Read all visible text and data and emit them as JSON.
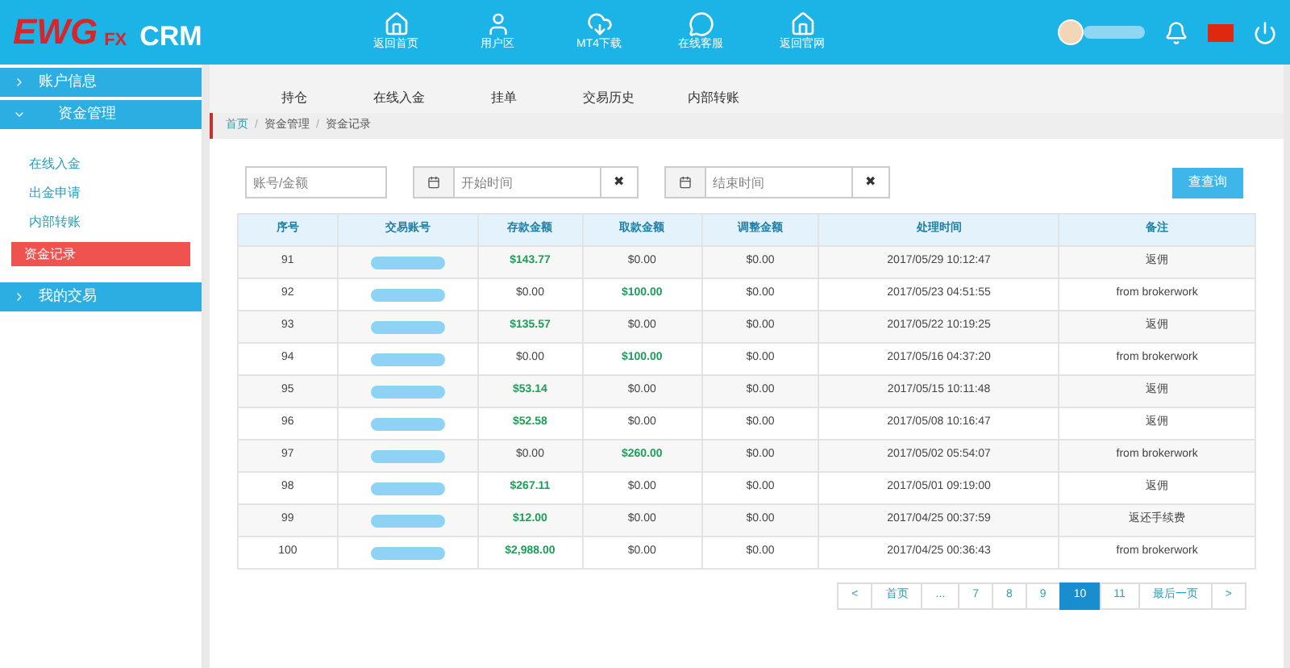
{
  "header": {
    "logo_main": "EWG",
    "logo_sub": "FX",
    "logo_crm": "CRM",
    "nav": [
      {
        "label": "返回首页",
        "kind": "home"
      },
      {
        "label": "用户区",
        "kind": "user"
      },
      {
        "label": "MT4下载",
        "kind": "download"
      },
      {
        "label": "在线客服",
        "kind": "chat"
      },
      {
        "label": "返回官网",
        "kind": "home"
      }
    ]
  },
  "sidebar": {
    "items": [
      {
        "label": "账户信息",
        "expanded": false
      },
      {
        "label": "资金管理",
        "expanded": true,
        "children": [
          {
            "label": "在线入金",
            "selected": false
          },
          {
            "label": "出金申请",
            "selected": false
          },
          {
            "label": "内部转账",
            "selected": false
          },
          {
            "label": "资金记录",
            "selected": true
          }
        ]
      },
      {
        "label": "我的交易",
        "expanded": false
      }
    ]
  },
  "tabs": [
    "持仓",
    "在线入金",
    "挂单",
    "交易历史",
    "内部转账"
  ],
  "breadcrumb": {
    "separator": "/",
    "items": [
      "首页",
      "资金管理",
      "资金记录"
    ]
  },
  "filters": {
    "account_placeholder": "账号/金额",
    "start_placeholder": "开始时间",
    "end_placeholder": "结束时间",
    "clear": "✖",
    "search_button": "查查询"
  },
  "table": {
    "columns": [
      "序号",
      "交易账号",
      "存款金额",
      "取款金额",
      "调整金额",
      "处理时间",
      "备注"
    ],
    "rows": [
      {
        "no": "91",
        "deposit": {
          "text": "$143.77",
          "emphasis": true
        },
        "withdraw": {
          "text": "$0.00",
          "emphasis": false
        },
        "adjust": "$0.00",
        "time": "2017/05/29 10:12:47",
        "note": "返佣"
      },
      {
        "no": "92",
        "deposit": {
          "text": "$0.00",
          "emphasis": false
        },
        "withdraw": {
          "text": "$100.00",
          "emphasis": true
        },
        "adjust": "$0.00",
        "time": "2017/05/23 04:51:55",
        "note": "from brokerwork"
      },
      {
        "no": "93",
        "deposit": {
          "text": "$135.57",
          "emphasis": true
        },
        "withdraw": {
          "text": "$0.00",
          "emphasis": false
        },
        "adjust": "$0.00",
        "time": "2017/05/22 10:19:25",
        "note": "返佣"
      },
      {
        "no": "94",
        "deposit": {
          "text": "$0.00",
          "emphasis": false
        },
        "withdraw": {
          "text": "$100.00",
          "emphasis": true
        },
        "adjust": "$0.00",
        "time": "2017/05/16 04:37:20",
        "note": "from brokerwork"
      },
      {
        "no": "95",
        "deposit": {
          "text": "$53.14",
          "emphasis": true
        },
        "withdraw": {
          "text": "$0.00",
          "emphasis": false
        },
        "adjust": "$0.00",
        "time": "2017/05/15 10:11:48",
        "note": "返佣"
      },
      {
        "no": "96",
        "deposit": {
          "text": "$52.58",
          "emphasis": true
        },
        "withdraw": {
          "text": "$0.00",
          "emphasis": false
        },
        "adjust": "$0.00",
        "time": "2017/05/08 10:16:47",
        "note": "返佣"
      },
      {
        "no": "97",
        "deposit": {
          "text": "$0.00",
          "emphasis": false
        },
        "withdraw": {
          "text": "$260.00",
          "emphasis": true
        },
        "adjust": "$0.00",
        "time": "2017/05/02 05:54:07",
        "note": "from brokerwork"
      },
      {
        "no": "98",
        "deposit": {
          "text": "$267.11",
          "emphasis": true
        },
        "withdraw": {
          "text": "$0.00",
          "emphasis": false
        },
        "adjust": "$0.00",
        "time": "2017/05/01 09:19:00",
        "note": "返佣"
      },
      {
        "no": "99",
        "deposit": {
          "text": "$12.00",
          "emphasis": true
        },
        "withdraw": {
          "text": "$0.00",
          "emphasis": false
        },
        "adjust": "$0.00",
        "time": "2017/04/25 00:37:59",
        "note": "返还手续费"
      },
      {
        "no": "100",
        "deposit": {
          "text": "$2,988.00",
          "emphasis": true
        },
        "withdraw": {
          "text": "$0.00",
          "emphasis": false
        },
        "adjust": "$0.00",
        "time": "2017/04/25 00:36:43",
        "note": "from brokerwork"
      }
    ]
  },
  "pagination": [
    {
      "label": "<",
      "selected": false
    },
    {
      "label": "首页",
      "selected": false
    },
    {
      "label": "...",
      "selected": false
    },
    {
      "label": "7",
      "selected": false
    },
    {
      "label": "8",
      "selected": false
    },
    {
      "label": "9",
      "selected": false
    },
    {
      "label": "10",
      "selected": true
    },
    {
      "label": "11",
      "selected": false
    },
    {
      "label": "最后一页",
      "selected": false
    },
    {
      "label": ">",
      "selected": false
    }
  ]
}
